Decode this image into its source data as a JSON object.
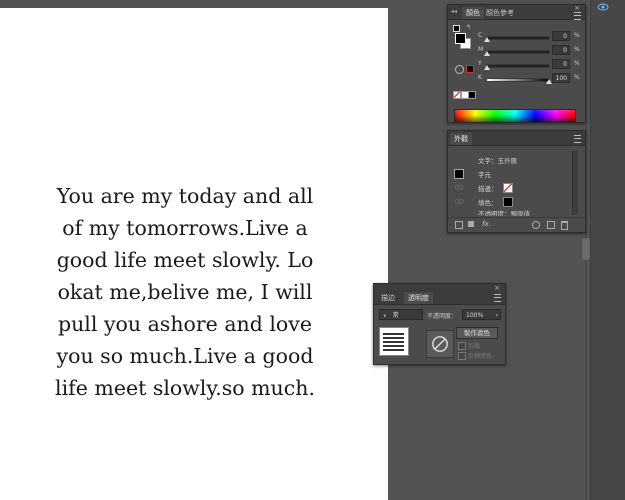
{
  "canvas": {
    "lines": [
      "You are my today and all",
      "of my tomorrows.Live a",
      "good life meet slowly. Lo",
      "okat me,belive me, I will",
      "pull you ashore and love",
      "you so much.Live a good",
      "life meet slowly.so much."
    ]
  },
  "color_panel": {
    "tabs": [
      "顏色",
      "顏色參考"
    ],
    "sliders": [
      {
        "label": "C",
        "value": "0",
        "unit": "%",
        "level": 0
      },
      {
        "label": "M",
        "value": "0",
        "unit": "%",
        "level": 0
      },
      {
        "label": "Y",
        "value": "0",
        "unit": "%",
        "level": 0
      },
      {
        "label": "K",
        "value": "100",
        "unit": "%",
        "level": 100
      }
    ]
  },
  "appearance_panel": {
    "tab": "外觀",
    "header": "文字：玉外匯",
    "items": [
      "字元",
      "描邊：",
      "填色："
    ],
    "footer": "不透明度：預設值",
    "fx_label": "fx."
  },
  "transparency_panel": {
    "tabs": [
      "描边",
      "透明度"
    ],
    "blend_mode": "常",
    "opacity_label": "不透明度：",
    "opacity_value": "100%",
    "make_mask_label": "製作遮色",
    "clip_label": "剪裁",
    "invert_label": "反轉遮色"
  },
  "colors": {
    "panel_bg": "#4b4b4b",
    "tab_bg": "#3c3c3c",
    "workspace": "#535353"
  }
}
